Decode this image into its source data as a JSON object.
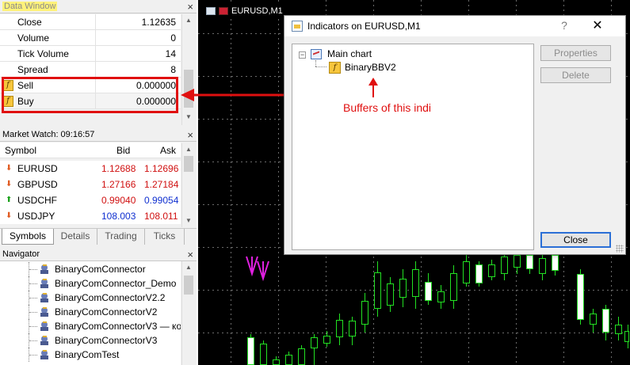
{
  "data_window": {
    "title": "Data Window",
    "rows": [
      {
        "key": "Close",
        "value": "1.12635"
      },
      {
        "key": "Volume",
        "value": "0"
      },
      {
        "key": "Tick Volume",
        "value": "14"
      },
      {
        "key": "Spread",
        "value": "8"
      },
      {
        "key": "Sell",
        "value": "0.000000"
      },
      {
        "key": "Buy",
        "value": "0.000000"
      }
    ]
  },
  "market_watch": {
    "title": "Market Watch: 09:16:57",
    "columns": [
      "Symbol",
      "Bid",
      "Ask"
    ],
    "rows": [
      {
        "symbol": "EURUSD",
        "bid": "1.12688",
        "ask": "1.12696",
        "dir": "down"
      },
      {
        "symbol": "GBPUSD",
        "bid": "1.27166",
        "ask": "1.27184",
        "dir": "down"
      },
      {
        "symbol": "USDCHF",
        "bid": "0.99040",
        "ask": "0.99054",
        "dir": "up"
      },
      {
        "symbol": "USDJPY",
        "bid": "108.003",
        "ask": "108.011",
        "dir": "down"
      }
    ],
    "tabs": [
      "Symbols",
      "Details",
      "Trading",
      "Ticks"
    ]
  },
  "navigator": {
    "title": "Navigator",
    "items": [
      "BinaryComConnector",
      "BinaryComConnector_Demo",
      "BinaryComConnectorV2.2",
      "BinaryComConnectorV2",
      "BinaryComConnectorV3 — ко",
      "BinaryComConnectorV3",
      "BinaryComTest"
    ]
  },
  "chart": {
    "tab_label": "EURUSD,M1"
  },
  "dialog": {
    "title": "Indicators on EURUSD,M1",
    "tree_root": "Main chart",
    "tree_child": "BinaryBBV2",
    "buttons": {
      "properties": "Properties",
      "delete": "Delete",
      "close": "Close"
    }
  },
  "annotation": {
    "text": "Buffers of this indi"
  },
  "colors": {
    "annotation": "#e01010",
    "bid_down": "#d01010",
    "bid_up": "#d01010",
    "ask_blue": "#1030d0",
    "candle": "#22e022",
    "marker": "#e020e0"
  }
}
